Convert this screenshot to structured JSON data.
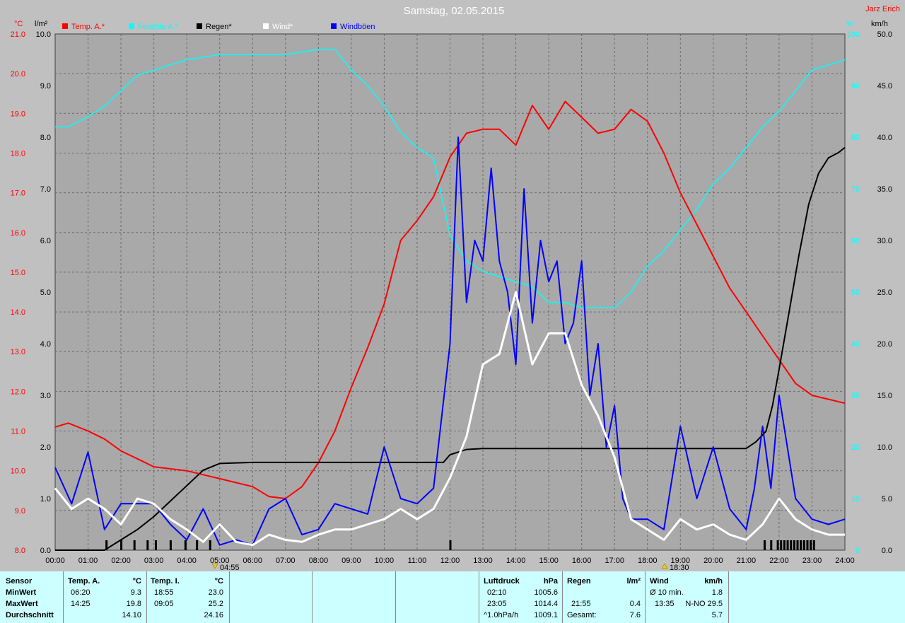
{
  "header": {
    "title": "Samstag, 02.05.2015",
    "author": "Jarz Erich",
    "unit_temp": "°C",
    "unit_rain": "l/m²",
    "unit_hum": "%",
    "unit_wind": "km/h"
  },
  "legend": [
    {
      "label": "Temp. A.*",
      "color": "#ff0000"
    },
    {
      "label": "Feuchte A.*",
      "color": "#00ffff"
    },
    {
      "label": "Regen*",
      "color": "#000000"
    },
    {
      "label": "Wind*",
      "color": "#ffffff"
    },
    {
      "label": "Windböen",
      "color": "#0000ff"
    }
  ],
  "markers": {
    "sunrise": "04:55",
    "sunset": "18:30"
  },
  "chart_data": {
    "type": "line",
    "x_unit": "hours",
    "x_ticks": [
      "00:00",
      "01:00",
      "02:00",
      "03:00",
      "04:00",
      "05:00",
      "06:00",
      "07:00",
      "08:00",
      "09:00",
      "10:00",
      "11:00",
      "12:00",
      "13:00",
      "14:00",
      "15:00",
      "16:00",
      "17:00",
      "18:00",
      "19:00",
      "20:00",
      "21:00",
      "22:00",
      "23:00",
      "24:00"
    ],
    "axes": {
      "temp": {
        "ylim": [
          8.0,
          21.0
        ],
        "ticks": [
          "8.0",
          "9.0",
          "10.0",
          "11.0",
          "12.0",
          "13.0",
          "14.0",
          "15.0",
          "16.0",
          "17.0",
          "18.0",
          "19.0",
          "20.0",
          "21.0"
        ]
      },
      "rain": {
        "ylim": [
          0.0,
          10.0
        ],
        "ticks": [
          "0.0",
          "1.0",
          "2.0",
          "3.0",
          "4.0",
          "5.0",
          "6.0",
          "7.0",
          "8.0",
          "9.0",
          "10.0"
        ]
      },
      "humidity": {
        "ylim": [
          0,
          100
        ],
        "ticks": [
          "0",
          "10",
          "20",
          "30",
          "40",
          "50",
          "60",
          "70",
          "80",
          "90",
          "100"
        ]
      },
      "wind": {
        "ylim": [
          0.0,
          50.0
        ],
        "ticks": [
          "0.0",
          "5.0",
          "10.0",
          "15.0",
          "20.0",
          "25.0",
          "30.0",
          "35.0",
          "40.0",
          "45.0",
          "50.0"
        ]
      }
    },
    "series": [
      {
        "name": "Temp. A.*",
        "axis": "temp",
        "color": "#ff0000",
        "x": [
          0,
          0.4,
          1,
          1.5,
          2,
          2.5,
          3,
          4,
          4.5,
          5,
          5.5,
          6,
          6.5,
          7,
          7.5,
          8,
          8.5,
          9,
          9.5,
          10,
          10.5,
          11,
          11.5,
          12,
          12.5,
          13,
          13.5,
          14,
          14.5,
          15,
          15.5,
          16,
          16.5,
          17,
          17.5,
          18,
          18.5,
          19,
          19.5,
          20,
          20.5,
          21,
          21.5,
          22,
          22.5,
          23,
          23.5,
          24
        ],
        "y": [
          11.1,
          11.2,
          11.0,
          10.8,
          10.5,
          10.3,
          10.1,
          10.0,
          9.9,
          9.8,
          9.7,
          9.6,
          9.35,
          9.3,
          9.6,
          10.2,
          11.0,
          12.1,
          13.1,
          14.2,
          15.8,
          16.3,
          16.9,
          17.9,
          18.5,
          18.6,
          18.6,
          18.2,
          19.2,
          18.6,
          19.3,
          18.9,
          18.5,
          18.6,
          19.1,
          18.8,
          18.0,
          17.0,
          16.2,
          15.4,
          14.6,
          14.0,
          13.4,
          12.8,
          12.2,
          11.9,
          11.8,
          11.7
        ]
      },
      {
        "name": "Feuchte A.*",
        "axis": "humidity",
        "color": "#00ffff",
        "x": [
          0,
          0.4,
          1,
          1.5,
          2,
          2.5,
          3,
          4,
          5,
          6,
          7,
          8,
          8.5,
          9,
          9.5,
          10,
          10.5,
          11,
          11.5,
          12,
          12.5,
          13,
          13.5,
          14,
          14.5,
          15,
          15.5,
          16,
          16.5,
          17,
          17.5,
          18,
          18.5,
          19,
          19.5,
          20,
          20.5,
          21,
          21.5,
          22,
          22.5,
          23,
          23.5,
          24
        ],
        "y": [
          82,
          82,
          84,
          86,
          89,
          92,
          93,
          95,
          96,
          96,
          96,
          97,
          97,
          93,
          90,
          86,
          81,
          78,
          76,
          61,
          56,
          54,
          53,
          52,
          51,
          48,
          48,
          47,
          47,
          47,
          50,
          55,
          58,
          62,
          66,
          71,
          74,
          78,
          82,
          85,
          89,
          93,
          94,
          95
        ]
      },
      {
        "name": "Regen*",
        "axis": "rain",
        "color": "#000000",
        "x": [
          0,
          1.5,
          2,
          2.5,
          3,
          3.5,
          4,
          4.5,
          5,
          6,
          7,
          8,
          9,
          10,
          11,
          11.8,
          12,
          12.5,
          13,
          14,
          15,
          16,
          17,
          18,
          19,
          20,
          21,
          21.3,
          21.6,
          21.8,
          22,
          22.3,
          22.6,
          22.9,
          23.2,
          23.5,
          23.8,
          24
        ],
        "y": [
          0,
          0,
          0.2,
          0.4,
          0.65,
          0.95,
          1.25,
          1.55,
          1.68,
          1.7,
          1.7,
          1.7,
          1.7,
          1.7,
          1.7,
          1.7,
          1.85,
          1.95,
          1.97,
          1.97,
          1.97,
          1.97,
          1.97,
          1.97,
          1.97,
          1.97,
          1.97,
          2.1,
          2.3,
          2.8,
          3.5,
          4.6,
          5.7,
          6.7,
          7.3,
          7.6,
          7.7,
          7.8
        ]
      },
      {
        "name": "Wind*",
        "axis": "wind",
        "color": "#ffffff",
        "x": [
          0,
          0.5,
          1,
          1.5,
          2,
          2.5,
          3,
          3.5,
          4,
          4.5,
          5,
          5.5,
          6,
          6.5,
          7,
          7.5,
          8,
          8.5,
          9,
          9.5,
          10,
          10.5,
          11,
          11.5,
          12,
          12.5,
          13,
          13.5,
          14,
          14.5,
          15,
          15.5,
          16,
          16.5,
          17,
          17.5,
          18,
          18.5,
          19,
          19.5,
          20,
          20.5,
          21,
          21.5,
          22,
          22.5,
          23,
          23.5,
          24
        ],
        "y": [
          6,
          4,
          5,
          4,
          2.5,
          5,
          4.5,
          3,
          2,
          0.8,
          2.5,
          0.8,
          0.5,
          1.5,
          1,
          0.8,
          1.5,
          2,
          2,
          2.5,
          3,
          4,
          3,
          4,
          7,
          11,
          18,
          19,
          25,
          18,
          21,
          21,
          16,
          13,
          9,
          3,
          2,
          1,
          3,
          2,
          2.5,
          1.5,
          1,
          2.5,
          5,
          3,
          2,
          1.5,
          1.5
        ]
      },
      {
        "name": "Windböen",
        "axis": "wind",
        "color": "#0000ff",
        "x": [
          0,
          0.5,
          1,
          1.5,
          2,
          2.5,
          3,
          3.5,
          4,
          4.5,
          5,
          5.5,
          6,
          6.5,
          7,
          7.5,
          8,
          8.5,
          9,
          9.5,
          10,
          10.5,
          11,
          11.5,
          12,
          12.25,
          12.5,
          12.75,
          13,
          13.25,
          13.5,
          13.75,
          14,
          14.25,
          14.5,
          14.75,
          15,
          15.25,
          15.5,
          15.75,
          16,
          16.25,
          16.5,
          16.75,
          17,
          17.25,
          17.5,
          18,
          18.5,
          19,
          19.5,
          20,
          20.5,
          21,
          21.25,
          21.5,
          21.75,
          22,
          22.5,
          23,
          23.5,
          24
        ],
        "y": [
          8,
          4.5,
          9.5,
          2,
          4.5,
          4.5,
          4.5,
          2.5,
          1,
          4,
          0.5,
          1,
          0.5,
          4,
          5,
          1.5,
          2,
          4.5,
          4,
          3.5,
          10,
          5,
          4.5,
          6,
          20,
          40,
          24,
          30,
          28,
          37,
          28,
          25,
          18,
          35,
          22,
          30,
          26,
          28,
          20,
          22,
          28,
          15,
          20,
          10,
          14,
          5,
          3,
          3,
          2,
          12,
          5,
          10,
          4,
          2,
          6,
          12,
          6,
          15,
          5,
          3,
          2.5,
          3
        ]
      }
    ]
  },
  "stats": {
    "sensor_col": {
      "header": "Sensor",
      "rows": [
        "MinWert",
        "MaxWert",
        "Durchschnitt"
      ]
    },
    "temp_a": {
      "header": "Temp. A.",
      "unit": "°C",
      "rows": [
        {
          "time": "06:20",
          "value": "9.3"
        },
        {
          "time": "14:25",
          "value": "19.8"
        },
        {
          "time": "",
          "value": "14.10"
        }
      ]
    },
    "temp_i": {
      "header": "Temp. I.",
      "unit": "°C",
      "rows": [
        {
          "time": "18:55",
          "value": "23.0"
        },
        {
          "time": "09:05",
          "value": "25.2"
        },
        {
          "time": "",
          "value": "24.16"
        }
      ]
    },
    "pressure": {
      "header": "Luftdruck",
      "unit": "hPa",
      "rows": [
        {
          "time": "02:10",
          "value": "1005.6"
        },
        {
          "time": "23:05",
          "value": "1014.4"
        },
        {
          "time": "^1.0hPa/h",
          "value": "1009.1"
        }
      ]
    },
    "rain": {
      "header": "Regen",
      "unit": "l/m²",
      "rows": [
        {
          "time": "",
          "value": ""
        },
        {
          "time": "21:55",
          "value": "0.4"
        },
        {
          "time": "Gesamt:",
          "value": "7.6"
        }
      ]
    },
    "wind": {
      "header": "Wind",
      "unit": "km/h",
      "rows": [
        {
          "time": "Ø 10 min.",
          "value": "1.8"
        },
        {
          "time": "13:35",
          "value": "N-NO 29.5"
        },
        {
          "time": "",
          "value": "5.7"
        }
      ]
    }
  }
}
